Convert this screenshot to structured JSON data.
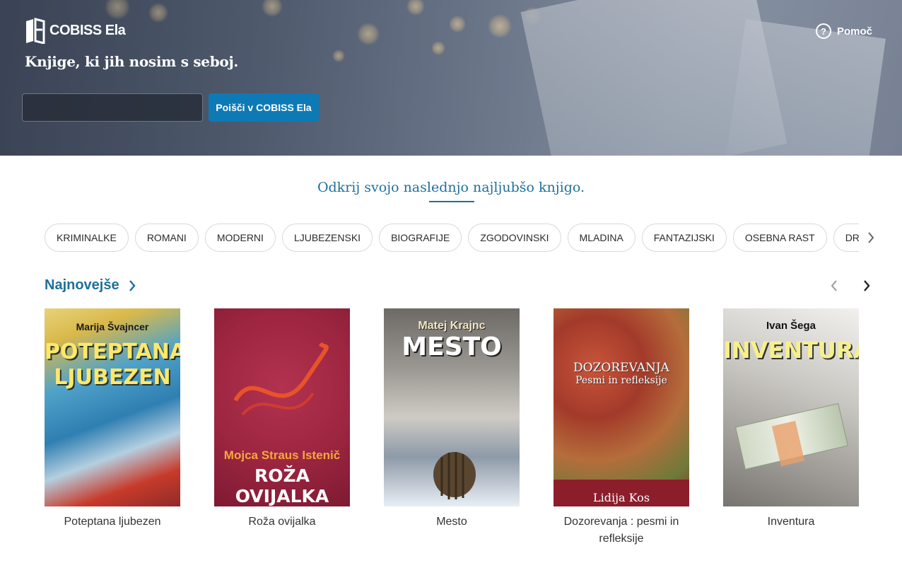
{
  "header": {
    "logo_text": "COBISS Ela",
    "tagline": "Knjige, ki jih nosim s seboj.",
    "search_placeholder": "",
    "search_button": "Poišči v COBISS Ela",
    "help_label": "Pomoč"
  },
  "discover": {
    "title": "Odkrij svojo naslednjo najljubšo knjigo."
  },
  "categories": [
    "KRIMINALKE",
    "ROMANI",
    "MODERNI",
    "LJUBEZENSKI",
    "BIOGRAFIJE",
    "ZGODOVINSKI",
    "MLADINA",
    "FANTAZIJSKI",
    "OSEBNA RAST",
    "DRUŽINSKI"
  ],
  "section": {
    "title": "Najnovejše"
  },
  "books": [
    {
      "title": "Poteptana ljubezen",
      "cover_author": "Marija Švajncer",
      "cover_title": "POTEPTANA LJUBEZEN"
    },
    {
      "title": "Roža ovijalka",
      "cover_author": "Mojca Straus Istenič",
      "cover_title": "ROŽA OVIJALKA"
    },
    {
      "title": "Mesto",
      "cover_author": "Matej Krajnc",
      "cover_title": "MESTO"
    },
    {
      "title": "Dozorevanja : pesmi in refleksije",
      "cover_author": "Lidija Kos",
      "cover_title": "DOZOREVANJA",
      "cover_subtitle": "Pesmi in refleksije"
    },
    {
      "title": "Inventura",
      "cover_author": "Ivan Šega",
      "cover_title": "INVENTURA"
    }
  ],
  "colors": {
    "accent": "#1f6f9a",
    "button": "#0d7ab6"
  }
}
